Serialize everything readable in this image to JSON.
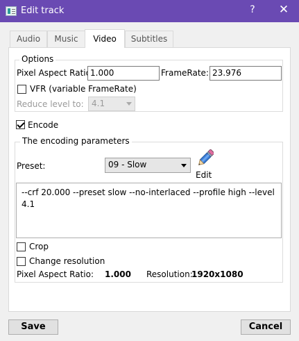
{
  "window": {
    "title": "Edit track",
    "help_glyph": "?",
    "close_glyph": "✕"
  },
  "tabs": [
    {
      "label": "Audio",
      "active": false
    },
    {
      "label": "Music",
      "active": false
    },
    {
      "label": "Video",
      "active": true
    },
    {
      "label": "Subtitles",
      "active": false
    }
  ],
  "options": {
    "group_label": "Options",
    "pixel_aspect_label": "Pixel Aspect Ratio",
    "pixel_aspect_value": "1.000",
    "framerate_label": "FrameRate:",
    "framerate_value": "23.976",
    "vfr_label": "VFR (variable FrameRate)",
    "vfr_checked": false,
    "reduce_label": "Reduce level to:",
    "reduce_value": "4.1"
  },
  "encode": {
    "label": "Encode",
    "checked": true
  },
  "encoding": {
    "group_label": "The encoding parameters",
    "preset_label": "Preset:",
    "preset_value": "09 - Slow",
    "edit_label": "Edit",
    "params": "--crf 20.000 --preset slow --no-interlaced --profile high --level 4.1",
    "crop_label": "Crop",
    "crop_checked": false,
    "change_res_label": "Change resolution",
    "change_res_checked": false,
    "par_label": "Pixel Aspect Ratio:",
    "par_value": "1.000",
    "resolution_label": "Resolution:",
    "resolution_value": "1920x1080"
  },
  "buttons": {
    "save": "Save",
    "cancel": "Cancel"
  },
  "colors": {
    "titlebar": "#6a4ab3",
    "window_bg": "#f0f0f0",
    "panel_bg": "#ffffff"
  }
}
